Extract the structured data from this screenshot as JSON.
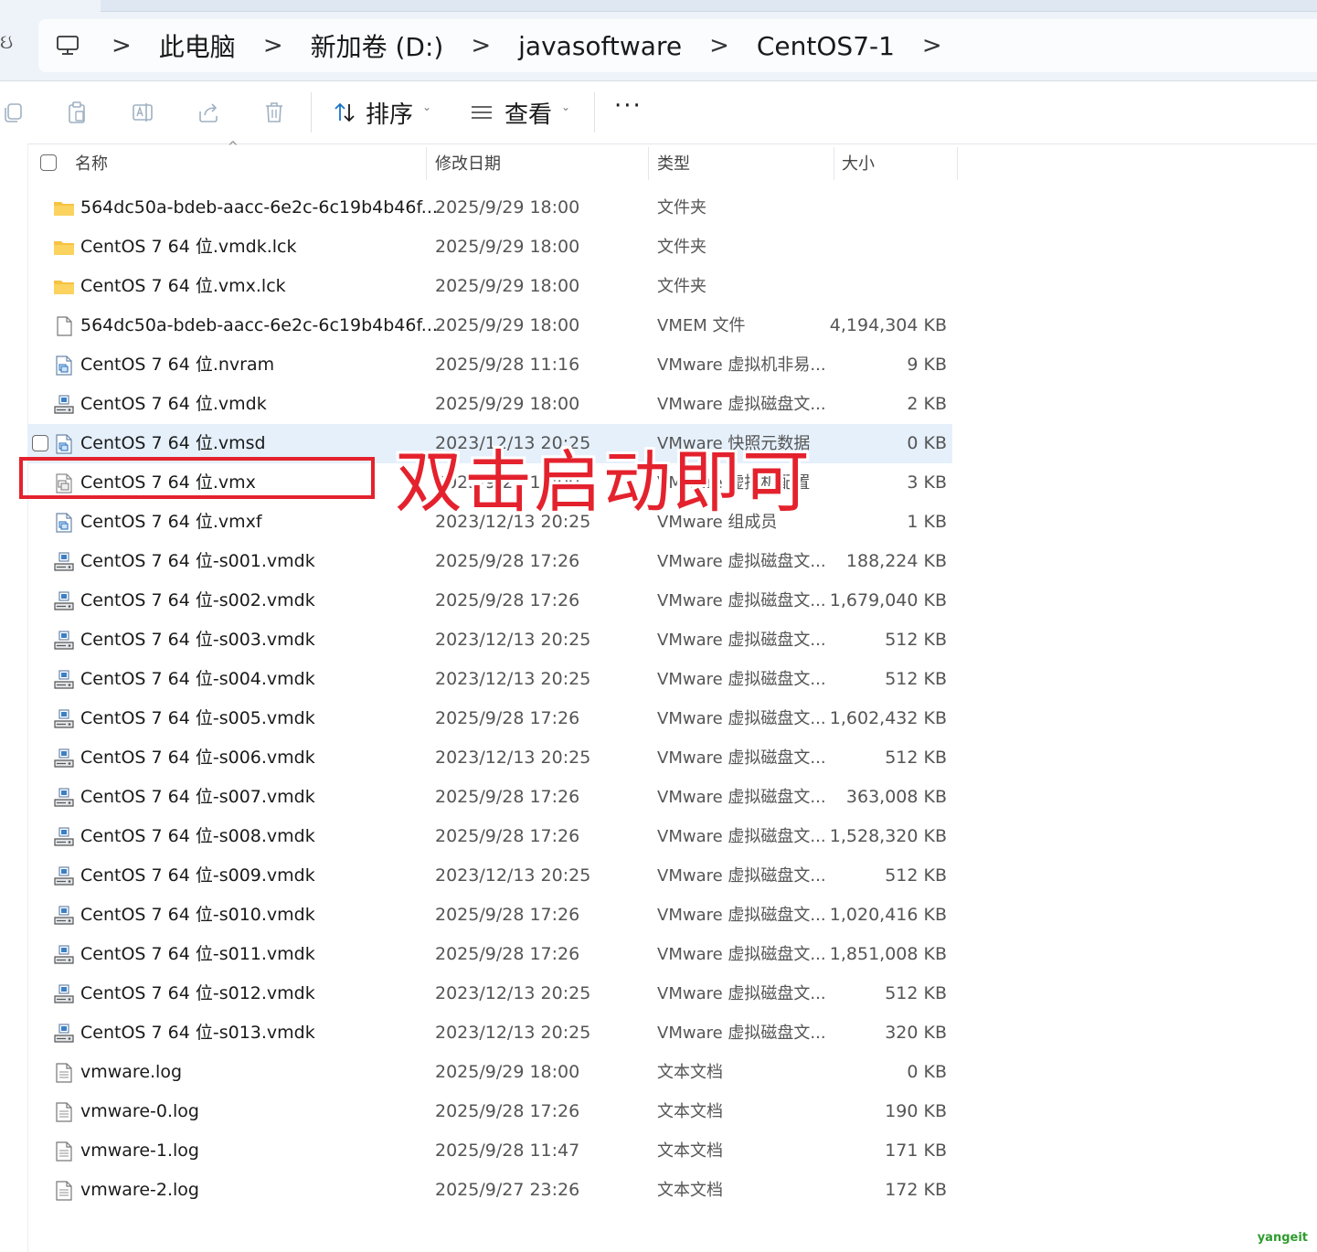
{
  "breadcrumb": {
    "items": [
      "此电脑",
      "新加卷 (D:)",
      "javasoftware",
      "CentOS7-1"
    ],
    "separator": ">"
  },
  "toolbar": {
    "sort_label": "排序",
    "view_label": "查看",
    "more_label": "···"
  },
  "columns": {
    "name": "名称",
    "modified": "修改日期",
    "type": "类型",
    "size": "大小"
  },
  "files": [
    {
      "icon": "folder-icon",
      "name": "564dc50a-bdeb-aacc-6e2c-6c19b4b46f...",
      "modified": "2025/9/29 18:00",
      "type": "文件夹",
      "size": ""
    },
    {
      "icon": "folder-icon",
      "name": "CentOS 7 64 位.vmdk.lck",
      "modified": "2025/9/29 18:00",
      "type": "文件夹",
      "size": ""
    },
    {
      "icon": "folder-icon",
      "name": "CentOS 7 64 位.vmx.lck",
      "modified": "2025/9/29 18:00",
      "type": "文件夹",
      "size": ""
    },
    {
      "icon": "blank-file-icon",
      "name": "564dc50a-bdeb-aacc-6e2c-6c19b4b46f...",
      "modified": "2025/9/29 18:00",
      "type": "VMEM 文件",
      "size": "4,194,304 KB"
    },
    {
      "icon": "vmware-file-icon",
      "name": "CentOS 7 64 位.nvram",
      "modified": "2025/9/28 11:16",
      "type": "VMware 虚拟机非易...",
      "size": "9 KB"
    },
    {
      "icon": "vmware-disk-icon",
      "name": "CentOS 7 64 位.vmdk",
      "modified": "2025/9/29 18:00",
      "type": "VMware 虚拟磁盘文...",
      "size": "2 KB"
    },
    {
      "icon": "vmware-file-icon",
      "name": "CentOS 7 64 位.vmsd",
      "modified": "2023/12/13 20:25",
      "type": "VMware 快照元数据",
      "size": "0 KB",
      "hover": true
    },
    {
      "icon": "vmware-vmx-icon",
      "name": "CentOS 7 64 位.vmx",
      "modified": "2025/9/29 18:00",
      "type": "VMware 虚拟机配置",
      "size": "3 KB"
    },
    {
      "icon": "vmware-file-icon",
      "name": "CentOS 7 64 位.vmxf",
      "modified": "2023/12/13 20:25",
      "type": "VMware 组成员",
      "size": "1 KB"
    },
    {
      "icon": "vmware-disk-icon",
      "name": "CentOS 7 64 位-s001.vmdk",
      "modified": "2025/9/28 17:26",
      "type": "VMware 虚拟磁盘文...",
      "size": "188,224 KB"
    },
    {
      "icon": "vmware-disk-icon",
      "name": "CentOS 7 64 位-s002.vmdk",
      "modified": "2025/9/28 17:26",
      "type": "VMware 虚拟磁盘文...",
      "size": "1,679,040 KB"
    },
    {
      "icon": "vmware-disk-icon",
      "name": "CentOS 7 64 位-s003.vmdk",
      "modified": "2023/12/13 20:25",
      "type": "VMware 虚拟磁盘文...",
      "size": "512 KB"
    },
    {
      "icon": "vmware-disk-icon",
      "name": "CentOS 7 64 位-s004.vmdk",
      "modified": "2023/12/13 20:25",
      "type": "VMware 虚拟磁盘文...",
      "size": "512 KB"
    },
    {
      "icon": "vmware-disk-icon",
      "name": "CentOS 7 64 位-s005.vmdk",
      "modified": "2025/9/28 17:26",
      "type": "VMware 虚拟磁盘文...",
      "size": "1,602,432 KB"
    },
    {
      "icon": "vmware-disk-icon",
      "name": "CentOS 7 64 位-s006.vmdk",
      "modified": "2023/12/13 20:25",
      "type": "VMware 虚拟磁盘文...",
      "size": "512 KB"
    },
    {
      "icon": "vmware-disk-icon",
      "name": "CentOS 7 64 位-s007.vmdk",
      "modified": "2025/9/28 17:26",
      "type": "VMware 虚拟磁盘文...",
      "size": "363,008 KB"
    },
    {
      "icon": "vmware-disk-icon",
      "name": "CentOS 7 64 位-s008.vmdk",
      "modified": "2025/9/28 17:26",
      "type": "VMware 虚拟磁盘文...",
      "size": "1,528,320 KB"
    },
    {
      "icon": "vmware-disk-icon",
      "name": "CentOS 7 64 位-s009.vmdk",
      "modified": "2023/12/13 20:25",
      "type": "VMware 虚拟磁盘文...",
      "size": "512 KB"
    },
    {
      "icon": "vmware-disk-icon",
      "name": "CentOS 7 64 位-s010.vmdk",
      "modified": "2025/9/28 17:26",
      "type": "VMware 虚拟磁盘文...",
      "size": "1,020,416 KB"
    },
    {
      "icon": "vmware-disk-icon",
      "name": "CentOS 7 64 位-s011.vmdk",
      "modified": "2025/9/28 17:26",
      "type": "VMware 虚拟磁盘文...",
      "size": "1,851,008 KB"
    },
    {
      "icon": "vmware-disk-icon",
      "name": "CentOS 7 64 位-s012.vmdk",
      "modified": "2023/12/13 20:25",
      "type": "VMware 虚拟磁盘文...",
      "size": "512 KB"
    },
    {
      "icon": "vmware-disk-icon",
      "name": "CentOS 7 64 位-s013.vmdk",
      "modified": "2023/12/13 20:25",
      "type": "VMware 虚拟磁盘文...",
      "size": "320 KB"
    },
    {
      "icon": "text-file-icon",
      "name": "vmware.log",
      "modified": "2025/9/29 18:00",
      "type": "文本文档",
      "size": "0 KB"
    },
    {
      "icon": "text-file-icon",
      "name": "vmware-0.log",
      "modified": "2025/9/28 17:26",
      "type": "文本文档",
      "size": "190 KB"
    },
    {
      "icon": "text-file-icon",
      "name": "vmware-1.log",
      "modified": "2025/9/28 11:47",
      "type": "文本文档",
      "size": "171 KB"
    },
    {
      "icon": "text-file-icon",
      "name": "vmware-2.log",
      "modified": "2025/9/27 23:26",
      "type": "文本文档",
      "size": "172 KB"
    }
  ],
  "annotation": {
    "text": "双击启动即可",
    "color": "#e4222d"
  },
  "watermark": "yangeit",
  "colors": {
    "hover_row": "#e5f0fb",
    "folder": "#f6c343",
    "accent": "#1a73c8"
  }
}
